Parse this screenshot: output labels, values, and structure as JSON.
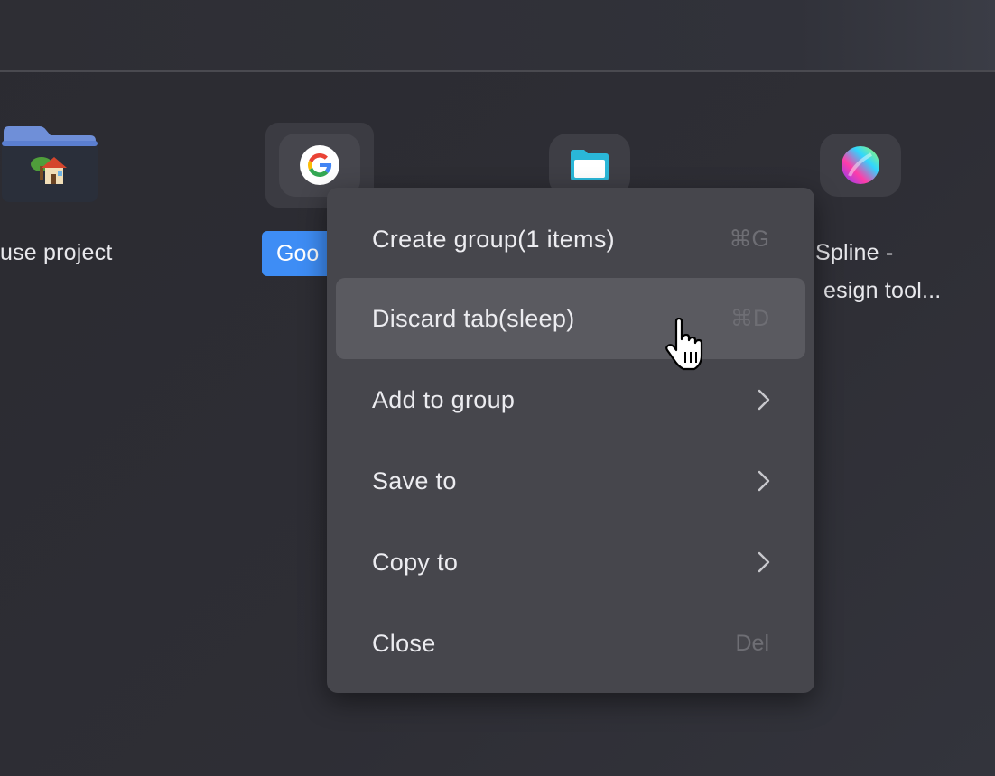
{
  "tiles": [
    {
      "id": "house-project",
      "label": "use project"
    },
    {
      "id": "google",
      "label": "Goo"
    },
    {
      "id": "files",
      "label": ""
    },
    {
      "id": "spline",
      "label_line1": "Spline -",
      "label_line2": "esign tool..."
    }
  ],
  "menu": {
    "items": [
      {
        "label": "Create group(1 items)",
        "shortcut": "⌘G"
      },
      {
        "label": "Discard tab(sleep)",
        "shortcut": "⌘D"
      },
      {
        "label": "Add to group",
        "submenu": true
      },
      {
        "label": "Save to",
        "submenu": true
      },
      {
        "label": "Copy to",
        "submenu": true
      },
      {
        "label": "Close",
        "shortcut": "Del"
      }
    ],
    "highlighted_index": 1
  },
  "colors": {
    "background": "#2e2e35",
    "menu_bg": "#46464c",
    "menu_highlight": "#5a5a60",
    "accent_badge": "#3e8df5",
    "shortcut_text": "#6e6e74"
  },
  "icons": [
    "folder-house-icon",
    "google-g-icon",
    "folder-icon",
    "spline-gradient-icon",
    "chevron-right-icon",
    "hand-pointer-cursor-icon"
  ]
}
